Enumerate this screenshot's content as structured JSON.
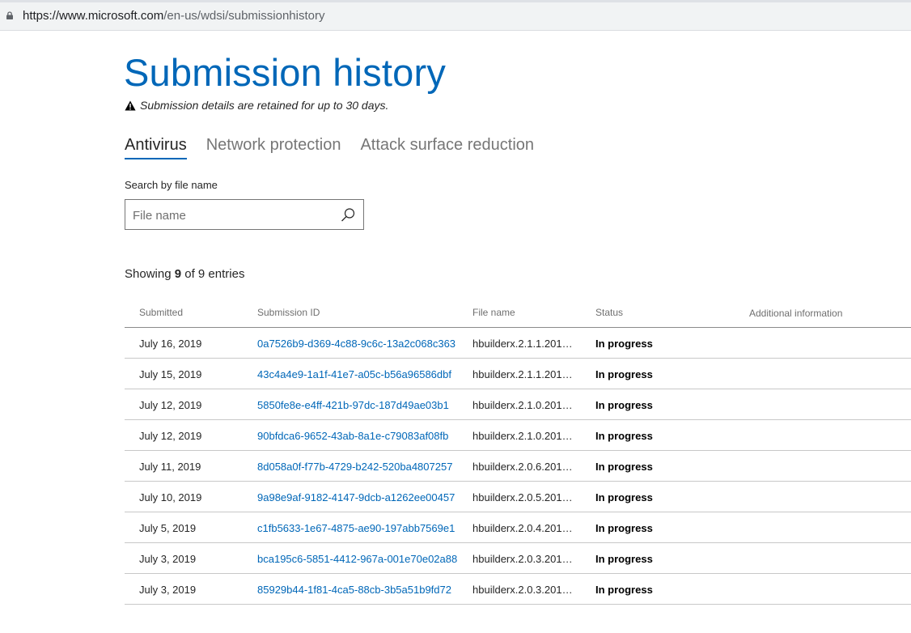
{
  "browser": {
    "url_host": "https://www.microsoft.com",
    "url_path": "/en-us/wdsi/submissionhistory"
  },
  "page": {
    "title": "Submission history",
    "notice": "Submission details are retained for up to 30 days."
  },
  "tabs": [
    {
      "label": "Antivirus",
      "active": true
    },
    {
      "label": "Network protection",
      "active": false
    },
    {
      "label": "Attack surface reduction",
      "active": false
    }
  ],
  "search": {
    "label": "Search by file name",
    "placeholder": "File name",
    "value": ""
  },
  "summary": {
    "prefix": "Showing",
    "shown": "9",
    "middle": "of 9 entries"
  },
  "table": {
    "columns": [
      "Submitted",
      "Submission ID",
      "File name",
      "Status",
      "Additional information"
    ],
    "rows": [
      {
        "submitted": "July 16, 2019",
        "id": "0a7526b9-d369-4c88-9c6c-13a2c068c363",
        "file": "hbuilderx.2.1.1.2019...",
        "status": "In progress",
        "info": ""
      },
      {
        "submitted": "July 15, 2019",
        "id": "43c4a4e9-1a1f-41e7-a05c-b56a96586dbf",
        "file": "hbuilderx.2.1.1.2019...",
        "status": "In progress",
        "info": ""
      },
      {
        "submitted": "July 12, 2019",
        "id": "5850fe8e-e4ff-421b-97dc-187d49ae03b1",
        "file": "hbuilderx.2.1.0.2019...",
        "status": "In progress",
        "info": ""
      },
      {
        "submitted": "July 12, 2019",
        "id": "90bfdca6-9652-43ab-8a1e-c79083af08fb",
        "file": "hbuilderx.2.1.0.2019...",
        "status": "In progress",
        "info": ""
      },
      {
        "submitted": "July 11, 2019",
        "id": "8d058a0f-f77b-4729-b242-520ba4807257",
        "file": "hbuilderx.2.0.6.2019...",
        "status": "In progress",
        "info": ""
      },
      {
        "submitted": "July 10, 2019",
        "id": "9a98e9af-9182-4147-9dcb-a1262ee00457",
        "file": "hbuilderx.2.0.5.2019...",
        "status": "In progress",
        "info": ""
      },
      {
        "submitted": "July 5, 2019",
        "id": "c1fb5633-1e67-4875-ae90-197abb7569e1",
        "file": "hbuilderx.2.0.4.2019...",
        "status": "In progress",
        "info": ""
      },
      {
        "submitted": "July 3, 2019",
        "id": "bca195c6-5851-4412-967a-001e70e02a88",
        "file": "hbuilderx.2.0.3.2019...",
        "status": "In progress",
        "info": ""
      },
      {
        "submitted": "July 3, 2019",
        "id": "85929b44-1f81-4ca5-88cb-3b5a51b9fd72",
        "file": "hbuilderx.2.0.3.2019...",
        "status": "In progress",
        "info": ""
      }
    ]
  },
  "colors": {
    "accent": "#0067b8",
    "text": "#262626",
    "muted": "#767676"
  }
}
